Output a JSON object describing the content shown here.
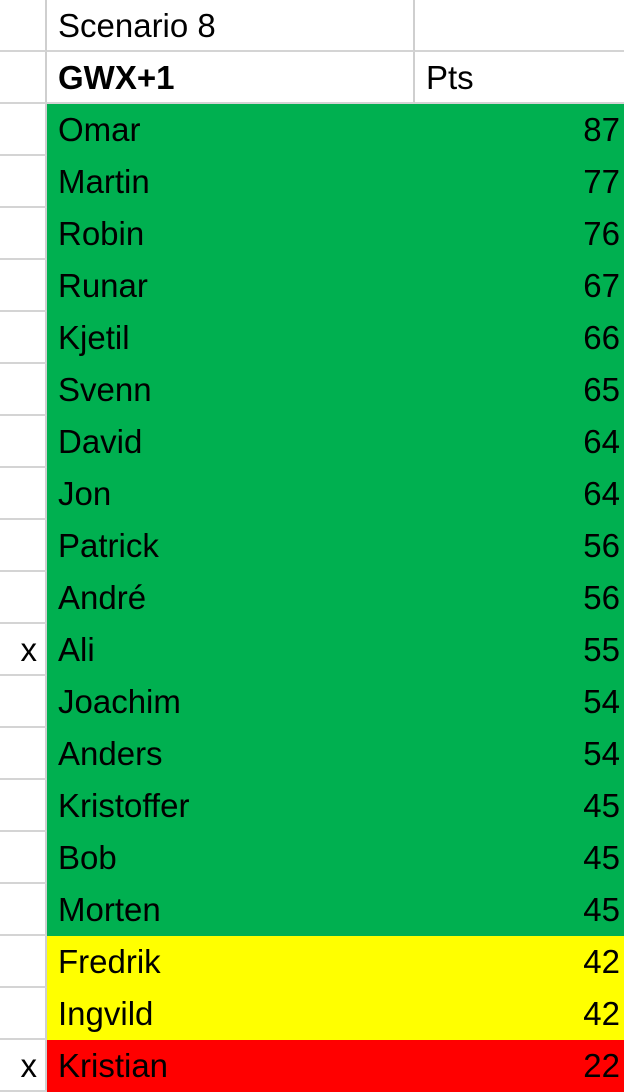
{
  "header": {
    "title": "Scenario 8",
    "col_name": "GWX+1",
    "col_pts": "Pts"
  },
  "colors": {
    "green": "#00b050",
    "yellow": "#ffff00",
    "red": "#ff0000"
  },
  "rows": [
    {
      "mark": "",
      "name": "Omar",
      "pts": "87",
      "band": "green"
    },
    {
      "mark": "",
      "name": "Martin",
      "pts": "77",
      "band": "green"
    },
    {
      "mark": "",
      "name": "Robin",
      "pts": "76",
      "band": "green"
    },
    {
      "mark": "",
      "name": "Runar",
      "pts": "67",
      "band": "green"
    },
    {
      "mark": "",
      "name": "Kjetil",
      "pts": "66",
      "band": "green"
    },
    {
      "mark": "",
      "name": "Svenn",
      "pts": "65",
      "band": "green"
    },
    {
      "mark": "",
      "name": "David",
      "pts": "64",
      "band": "green"
    },
    {
      "mark": "",
      "name": "Jon",
      "pts": "64",
      "band": "green"
    },
    {
      "mark": "",
      "name": "Patrick",
      "pts": "56",
      "band": "green"
    },
    {
      "mark": "",
      "name": "André",
      "pts": "56",
      "band": "green"
    },
    {
      "mark": "x",
      "name": "Ali",
      "pts": "55",
      "band": "green"
    },
    {
      "mark": "",
      "name": "Joachim",
      "pts": "54",
      "band": "green"
    },
    {
      "mark": "",
      "name": "Anders",
      "pts": "54",
      "band": "green"
    },
    {
      "mark": "",
      "name": "Kristoffer",
      "pts": "45",
      "band": "green"
    },
    {
      "mark": "",
      "name": "Bob",
      "pts": "45",
      "band": "green"
    },
    {
      "mark": "",
      "name": "Morten",
      "pts": "45",
      "band": "green"
    },
    {
      "mark": "",
      "name": "Fredrik",
      "pts": "42",
      "band": "yellow"
    },
    {
      "mark": "",
      "name": "Ingvild",
      "pts": "42",
      "band": "yellow"
    },
    {
      "mark": "x",
      "name": "Kristian",
      "pts": "22",
      "band": "red"
    }
  ]
}
